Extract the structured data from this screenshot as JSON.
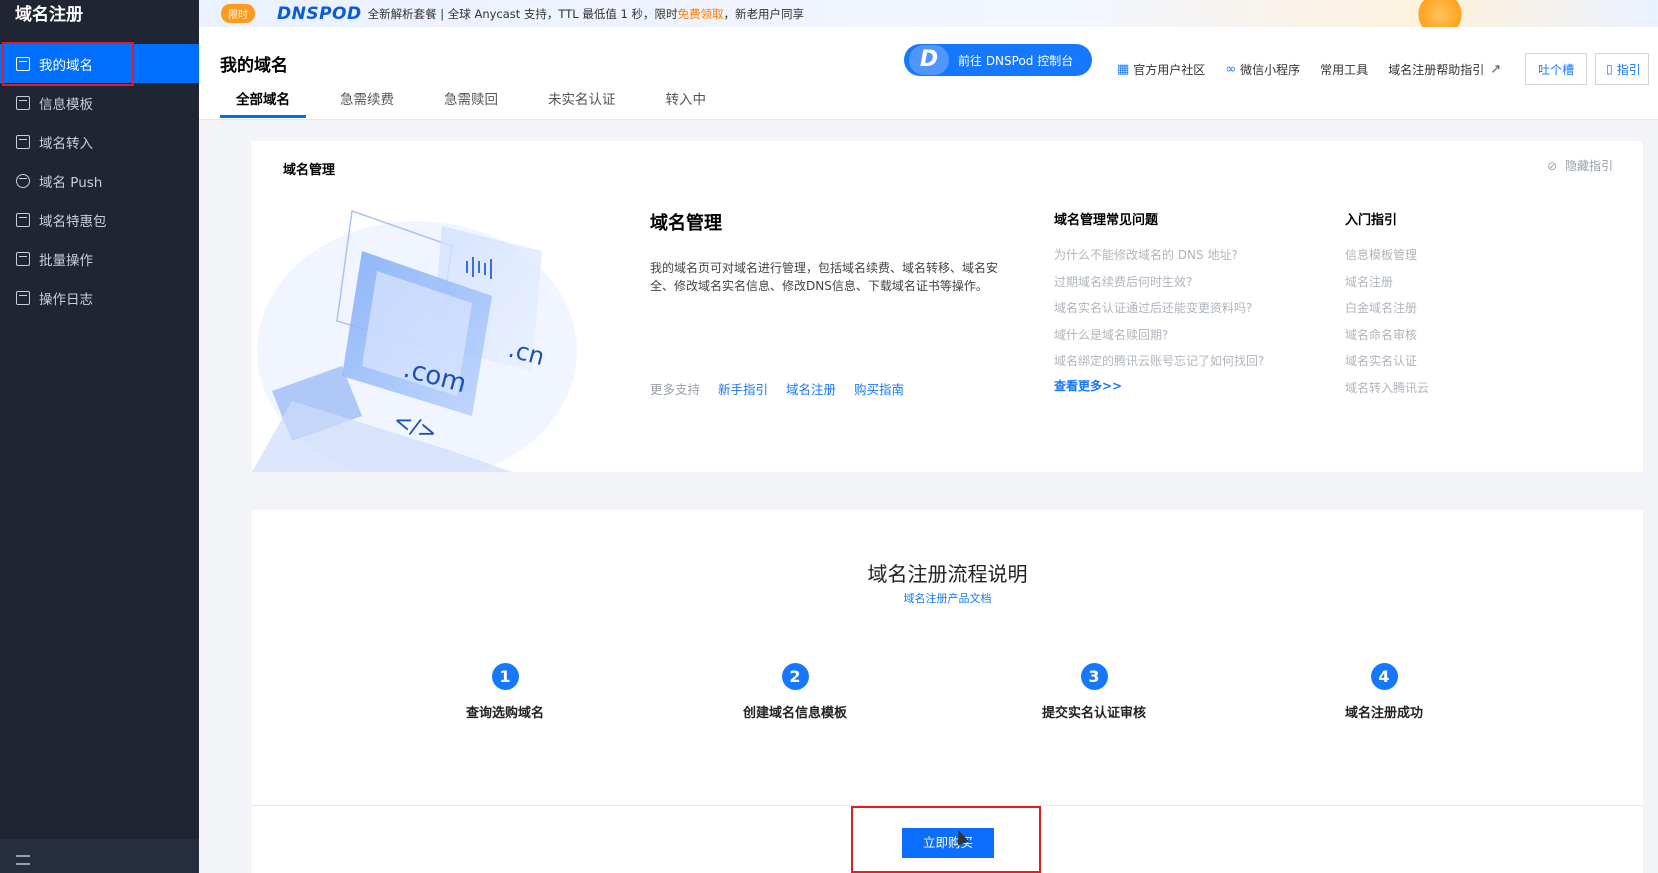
{
  "sidebar": {
    "title": "域名注册",
    "items": [
      {
        "label": "我的域名",
        "icon": "domain-icon",
        "active": true
      },
      {
        "label": "信息模板",
        "icon": "template-icon"
      },
      {
        "label": "域名转入",
        "icon": "transfer-icon"
      },
      {
        "label": "域名 Push",
        "icon": "push-icon"
      },
      {
        "label": "域名特惠包",
        "icon": "gift-icon"
      },
      {
        "label": "批量操作",
        "icon": "batch-icon"
      },
      {
        "label": "操作日志",
        "icon": "log-icon"
      }
    ]
  },
  "banner": {
    "badge": "限时",
    "brand": "DNSPOD",
    "text_1": "全新解析套餐 | 全球 Anycast 支持，TTL 最低值 1 秒，限时",
    "highlight": "免费领取",
    "text_2": "，新老用户同享"
  },
  "header": {
    "title": "我的域名",
    "tabs": [
      "全部域名",
      "急需续费",
      "急需赎回",
      "未实名认证",
      "转入中"
    ],
    "dnspod_button": "前往 DNSPod 控制台",
    "dnspod_icon_letter": "D",
    "links": [
      "官方用户社区",
      "微信小程序",
      "常用工具",
      "域名注册帮助指引"
    ],
    "feedback_button": "吐个槽",
    "guide_button": "指引"
  },
  "domain_mgmt": {
    "card_title": "域名管理",
    "hide_guide": "隐藏指引",
    "intro_title": "域名管理",
    "intro_text": "我的域名页可对域名进行管理，包括域名续费、域名转移、域名安全、修改域名实名信息、修改DNS信息、下载域名证书等操作。",
    "more_support_label": "更多支持",
    "support_links": [
      "新手指引",
      "域名注册",
      "购买指南"
    ],
    "illustration_text": [
      ".com",
      ".cn",
      "</>"
    ],
    "faq_title": "域名管理常见问题",
    "faq": [
      "为什么不能修改域名的 DNS 地址?",
      "过期域名续费后何时生效?",
      "域名实名认证通过后还能变更资料吗?",
      "域什么是域名赎回期?",
      "域名绑定的腾讯云账号忘记了如何找回?"
    ],
    "faq_more": "查看更多>>",
    "guide_title": "入门指引",
    "guide": [
      "信息模板管理",
      "域名注册",
      "白金域名注册",
      "域名命名审核",
      "域名实名认证",
      "域名转入腾讯云"
    ]
  },
  "flow": {
    "title": "域名注册流程说明",
    "subtitle": "域名注册产品文档",
    "steps": [
      {
        "num": "1",
        "label": "查询选购域名"
      },
      {
        "num": "2",
        "label": "创建域名信息模板"
      },
      {
        "num": "3",
        "label": "提交实名认证审核"
      },
      {
        "num": "4",
        "label": "域名注册成功"
      }
    ],
    "buy_button": "立即购买"
  },
  "colors": {
    "sidebar_bg": "#1f2533",
    "accent": "#006eff",
    "highlight_box": "#e02020"
  }
}
